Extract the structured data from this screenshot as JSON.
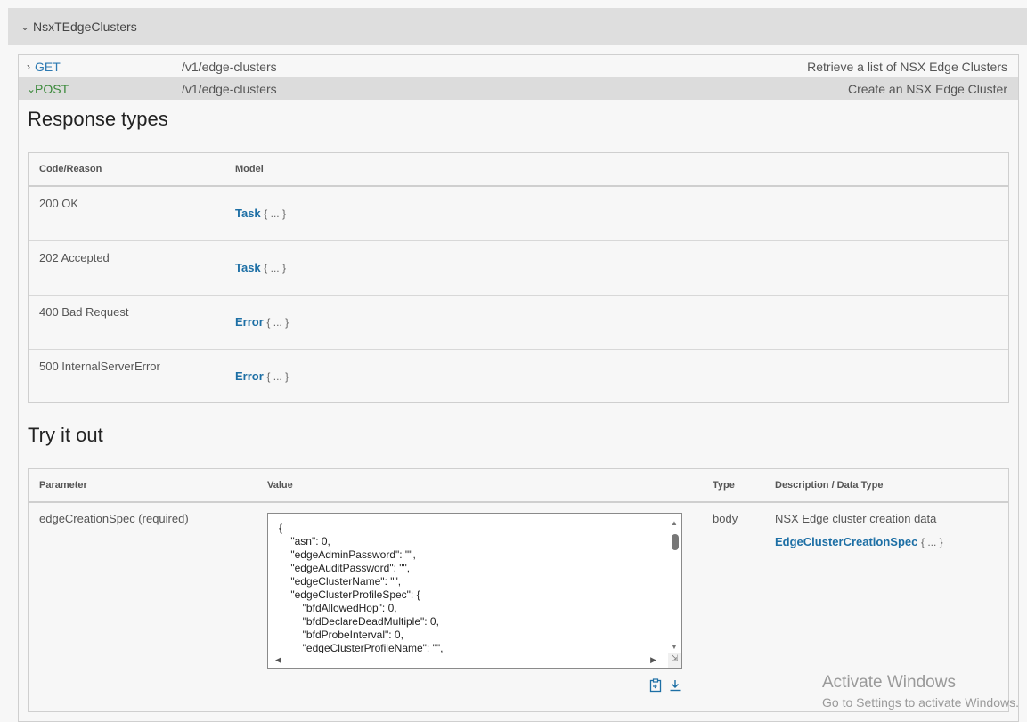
{
  "group": {
    "title": "NsxTEdgeClusters"
  },
  "operations": [
    {
      "method": "GET",
      "path": "/v1/edge-clusters",
      "summary": "Retrieve a list of NSX Edge Clusters"
    },
    {
      "method": "POST",
      "path": "/v1/edge-clusters",
      "summary": "Create an NSX Edge Cluster"
    }
  ],
  "responses": {
    "title": "Response types",
    "headers": {
      "code": "Code/Reason",
      "model": "Model"
    },
    "rows": [
      {
        "code": "200 OK",
        "model": "Task",
        "braces": "{ ... }"
      },
      {
        "code": "202 Accepted",
        "model": "Task",
        "braces": "{ ... }"
      },
      {
        "code": "400 Bad Request",
        "model": "Error",
        "braces": "{ ... }"
      },
      {
        "code": "500 InternalServerError",
        "model": "Error",
        "braces": "{ ... }"
      }
    ]
  },
  "try_it": {
    "title": "Try it out",
    "headers": {
      "parameter": "Parameter",
      "value": "Value",
      "type": "Type",
      "description": "Description / Data Type"
    },
    "param": {
      "name": "edgeCreationSpec (required)",
      "type": "body",
      "description": "NSX Edge cluster creation data",
      "model": "EdgeClusterCreationSpec",
      "braces": "{ ... }",
      "value": "{\n    \"asn\": 0,\n    \"edgeAdminPassword\": \"\",\n    \"edgeAuditPassword\": \"\",\n    \"edgeClusterName\": \"\",\n    \"edgeClusterProfileSpec\": {\n        \"bfdAllowedHop\": 0,\n        \"bfdDeclareDeadMultiple\": 0,\n        \"bfdProbeInterval\": 0,\n        \"edgeClusterProfileName\": \"\","
    },
    "icons": [
      "clipboard-icon",
      "download-icon"
    ]
  },
  "watermark": {
    "line1": "Activate Windows",
    "line2": "Go to Settings to activate Windows."
  },
  "colors": {
    "link": "#1d6fa5",
    "get": "#2d7ab2",
    "post": "#3c8a3c",
    "header_bg": "#dedede"
  }
}
